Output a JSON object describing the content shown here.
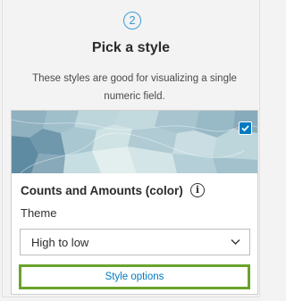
{
  "step": {
    "number": "2"
  },
  "header": {
    "title": "Pick a style",
    "description": "These styles are good for visualizing a single numeric field."
  },
  "style_card": {
    "name": "Counts and Amounts (color)",
    "selected": true,
    "theme_label": "Theme",
    "theme_value": "High to low",
    "options_button": "Style options"
  },
  "colors": {
    "accent": "#007ac2",
    "step_circle": "#3a9dd6",
    "highlight_border": "#6aa32c"
  },
  "icons": {
    "check": "check-icon",
    "info": "info-icon",
    "chevron": "chevron-down-icon"
  }
}
